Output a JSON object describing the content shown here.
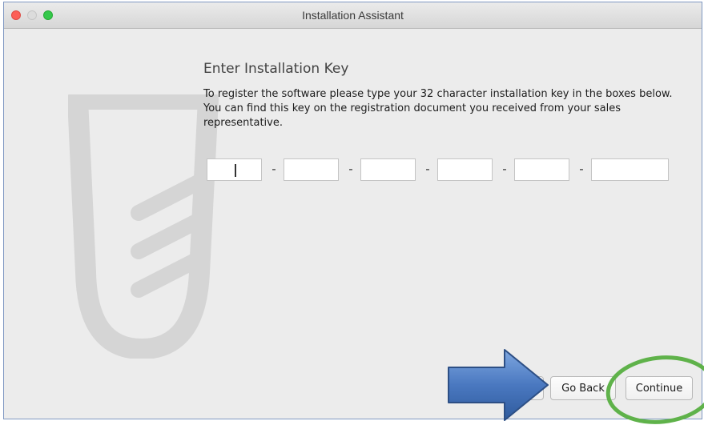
{
  "window": {
    "title": "Installation Assistant"
  },
  "content": {
    "heading": "Enter Installation Key",
    "description": "To register the software please type your 32 character installation key in the boxes below. You can find this key on the registration document you received from your sales representative."
  },
  "key_fields": {
    "separator": "-",
    "values": [
      "",
      "",
      "",
      "",
      "",
      ""
    ]
  },
  "buttons": {
    "back_label": "Go Back",
    "continue_label": "Continue"
  },
  "colors": {
    "annotation_arrow": "#4a78c0",
    "annotation_circle": "#5fb24a"
  },
  "icons": {
    "watermark": "tube-logo-icon"
  }
}
